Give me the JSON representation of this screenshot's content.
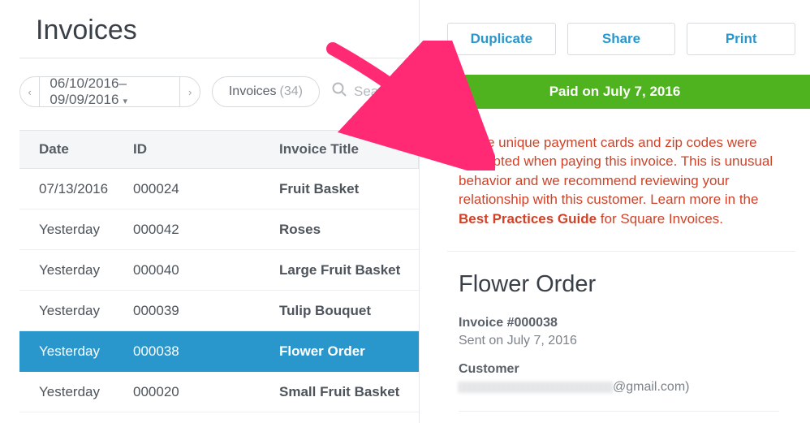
{
  "page": {
    "title": "Invoices"
  },
  "filters": {
    "date_range": "06/10/2016–09/09/2016",
    "pill_label": "Invoices",
    "pill_count": "(34)",
    "search_placeholder": "Search in"
  },
  "table": {
    "headers": {
      "date": "Date",
      "id": "ID",
      "title": "Invoice Title"
    },
    "rows": [
      {
        "date": "07/13/2016",
        "id": "000024",
        "title": "Fruit Basket",
        "selected": false
      },
      {
        "date": "Yesterday",
        "id": "000042",
        "title": "Roses",
        "selected": false
      },
      {
        "date": "Yesterday",
        "id": "000040",
        "title": "Large Fruit Basket",
        "selected": false
      },
      {
        "date": "Yesterday",
        "id": "000039",
        "title": "Tulip Bouquet",
        "selected": false
      },
      {
        "date": "Yesterday",
        "id": "000038",
        "title": "Flower Order",
        "selected": true
      },
      {
        "date": "Yesterday",
        "id": "000020",
        "title": "Small Fruit Basket",
        "selected": false
      }
    ]
  },
  "detail": {
    "actions": {
      "duplicate": "Duplicate",
      "share": "Share",
      "print": "Print"
    },
    "status": "Paid on July 7, 2016",
    "warning_text": "Three unique payment cards and zip codes were attempted when paying this invoice. This is unusual behavior and we recommend reviewing your relationship with this customer. Learn more in the ",
    "warning_link": "Best Practices Guide",
    "warning_tail": " for Square Invoices.",
    "title": "Flower Order",
    "invoice_no_label": "Invoice #000038",
    "sent_on": "Sent on July 7, 2016",
    "customer_label": "Customer",
    "customer_email_suffix": "@gmail.com)"
  }
}
